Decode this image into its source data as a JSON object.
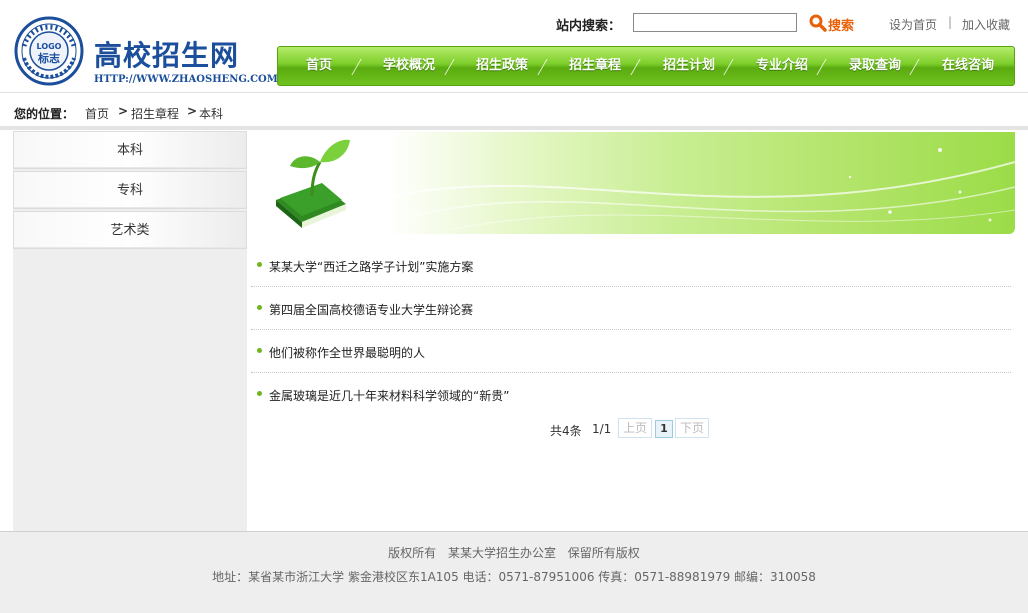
{
  "header": {
    "logo_title": "高校招生网",
    "logo_url": "HTTP://WWW.ZHAOSHENG.COM",
    "logo_badge_top": "LOGO",
    "logo_badge_bottom": "标志",
    "search_label": "站内搜索：",
    "search_value": "",
    "search_button": "搜索",
    "set_home": "设为首页",
    "divider": "|",
    "add_favorite": "加入收藏"
  },
  "nav": {
    "items": [
      {
        "label": "首页"
      },
      {
        "label": "学校概况"
      },
      {
        "label": "招生政策"
      },
      {
        "label": "招生章程"
      },
      {
        "label": "招生计划"
      },
      {
        "label": "专业介绍"
      },
      {
        "label": "录取查询"
      },
      {
        "label": "在线咨询"
      }
    ]
  },
  "breadcrumb": {
    "prefix": "您的位置：",
    "home": "首页",
    "sep": ">",
    "parent": "招生章程",
    "current": "本科"
  },
  "sidebar": {
    "items": [
      {
        "label": "本科"
      },
      {
        "label": "专科"
      },
      {
        "label": "艺术类"
      }
    ]
  },
  "news": {
    "items": [
      {
        "title": "某某大学“西迁之路学子计划”实施方案"
      },
      {
        "title": "第四届全国高校德语专业大学生辩论赛"
      },
      {
        "title": "他们被称作全世界最聪明的人"
      },
      {
        "title": "金属玻璃是近几十年来材料科学领域的“新贵”"
      }
    ]
  },
  "pager": {
    "total": "共4条",
    "pages": "1/1",
    "prev": "上页",
    "current": "1",
    "next": "下页"
  },
  "footer": {
    "line1": "版权所有 某某大学招生办公室 保留所有版权",
    "line2": "地址：某省某市浙江大学 紫金港校区东1A105 电话：0571-87951006 传真：0571-88981979 邮编：310058"
  },
  "colors": {
    "brand_blue": "#1b4e9b",
    "nav_green": "#6fc21e",
    "search_orange": "#e8620a"
  }
}
